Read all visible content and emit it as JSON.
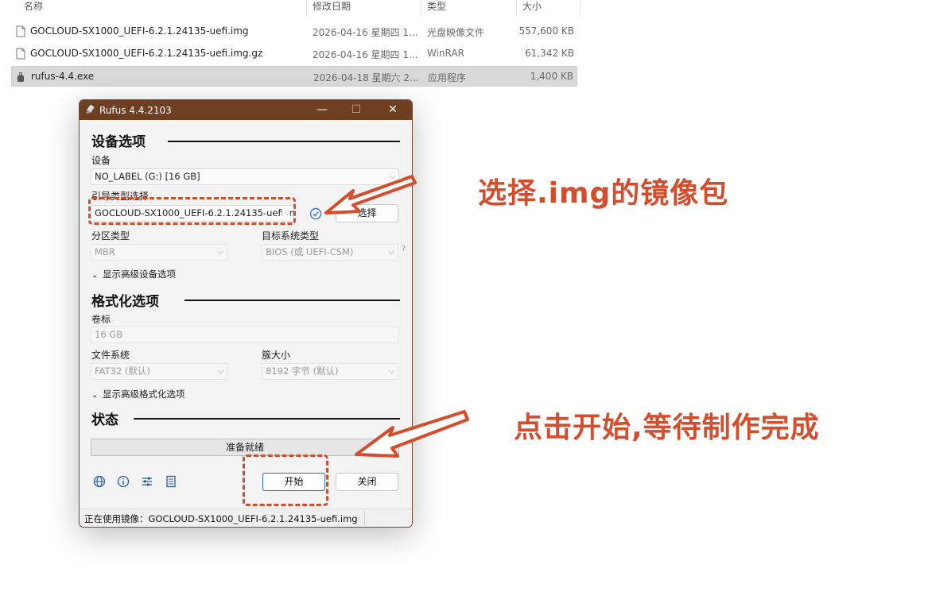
{
  "explorer": {
    "columns": {
      "name": "名称",
      "date": "修改日期",
      "type": "类型",
      "size": "大小"
    },
    "files": [
      {
        "name": "GOCLOUD-SX1000_UEFI-6.2.1.24135-uefi.img",
        "date": "2026-04-16 星期四 1...",
        "type": "光盘映像文件",
        "size": "557,600 KB"
      },
      {
        "name": "GOCLOUD-SX1000_UEFI-6.2.1.24135-uefi.img.gz",
        "date": "2026-04-16 星期四 1...",
        "type": "WinRAR",
        "size": "61,342 KB"
      },
      {
        "name": "rufus-4.4.exe",
        "date": "2026-04-18 星期六 2...",
        "type": "应用程序",
        "size": "1,400 KB"
      }
    ]
  },
  "rufus": {
    "title": "Rufus 4.4.2103",
    "window_buttons": {
      "minimize": "—",
      "maximize": "☐",
      "close": "✕"
    },
    "device_section": {
      "heading": "设备选项",
      "device_label": "设备",
      "device_value": "NO_LABEL (G:) [16 GB]",
      "boot_label": "引导类型选择",
      "boot_value": "GOCLOUD-SX1000_UEFI-6.2.1.24135-uefi.img",
      "select_button": "选择",
      "partition_label": "分区类型",
      "partition_value": "MBR",
      "target_label": "目标系统类型",
      "target_value": "BIOS (或 UEFI-CSM)",
      "target_help": "?",
      "advanced_toggle": "显示高级设备选项"
    },
    "format_section": {
      "heading": "格式化选项",
      "volume_label": "卷标",
      "volume_value": "16 GB",
      "fs_label": "文件系统",
      "fs_value": "FAT32 (默认)",
      "cluster_label": "簇大小",
      "cluster_value": "8192 字节 (默认)",
      "advanced_toggle": "显示高级格式化选项"
    },
    "status_section": {
      "heading": "状态",
      "progress_text": "准备就绪"
    },
    "start_button": "开始",
    "close_button": "关闭",
    "statusbar_text": "正在使用镜像：GOCLOUD-SX1000_UEFI-6.2.1.24135-uefi.img"
  },
  "annotations": {
    "select_image": "选择.img的镜像包",
    "click_start": "点击开始,等待制作完成",
    "color": "#d44d2c"
  }
}
